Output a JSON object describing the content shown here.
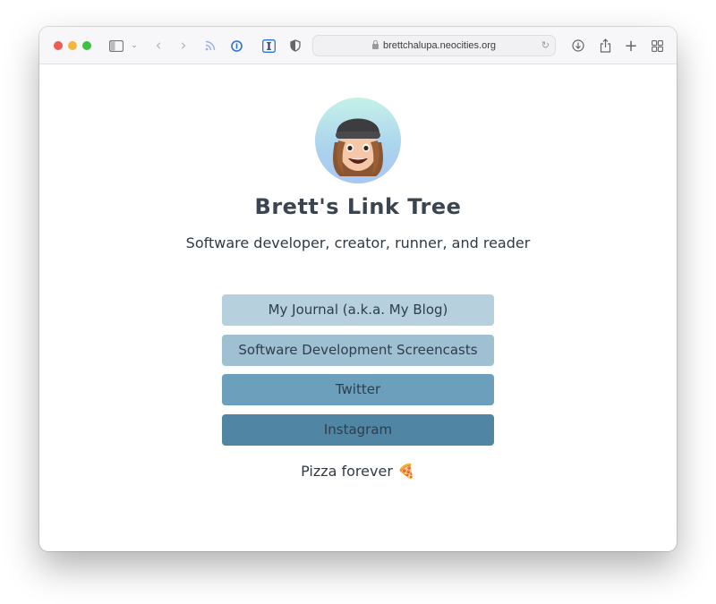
{
  "browser": {
    "url": "brettchalupa.neocities.org",
    "toolbar_icons": [
      "sidebar-icon",
      "chevron-down-icon",
      "back-icon",
      "forward-icon",
      "rss-icon",
      "onepassword-icon",
      "instapaper-icon",
      "shield-icon",
      "lock-icon",
      "reload-icon",
      "download-icon",
      "share-icon",
      "new-tab-icon",
      "tab-overview-icon"
    ]
  },
  "page": {
    "title": "Brett's Link Tree",
    "subtitle": "Software developer, creator, runner, and reader",
    "links": [
      {
        "label": "My Journal (a.k.a. My Blog)",
        "color": "#b6d0de"
      },
      {
        "label": "Software Development Screencasts",
        "color": "#9fc0d3"
      },
      {
        "label": "Twitter",
        "color": "#6b9fbb"
      },
      {
        "label": "Instagram",
        "color": "#5086a4"
      }
    ],
    "footer": "Pizza forever 🍕"
  }
}
